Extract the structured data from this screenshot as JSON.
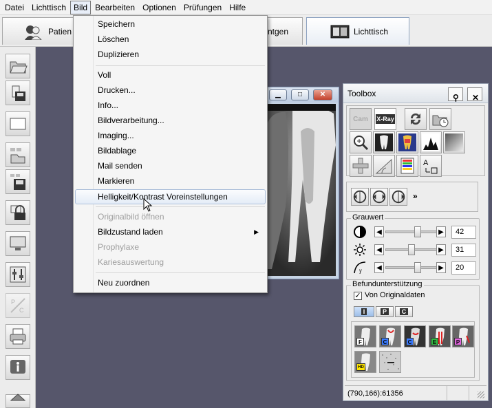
{
  "menubar": {
    "items": [
      "Datei",
      "Lichttisch",
      "Bild",
      "Bearbeiten",
      "Optionen",
      "Prüfungen",
      "Hilfe"
    ]
  },
  "tabs": [
    {
      "label": "Patien",
      "icon": "patient-icon"
    },
    {
      "label": "ntgen",
      "icon": "xray-icon"
    },
    {
      "label": "Lichttisch",
      "icon": "lighttable-icon"
    }
  ],
  "bild_menu": {
    "items": [
      {
        "label": "Speichern",
        "enabled": true
      },
      {
        "label": "Löschen",
        "enabled": true
      },
      {
        "label": "Duplizieren",
        "enabled": true
      },
      {
        "label": "Voll",
        "enabled": true
      },
      {
        "label": "Drucken...",
        "enabled": true
      },
      {
        "label": "Info...",
        "enabled": true
      },
      {
        "label": "Bildverarbeitung...",
        "enabled": true
      },
      {
        "label": "Imaging...",
        "enabled": true
      },
      {
        "label": "Bildablage",
        "enabled": true
      },
      {
        "label": "Mail senden",
        "enabled": true
      },
      {
        "label": "Markieren",
        "enabled": true
      },
      {
        "label": "Helligkeit/Kontrast Voreinstellungen",
        "enabled": true,
        "highlighted": true
      },
      {
        "label": "Originalbild öffnen",
        "enabled": false
      },
      {
        "label": "Bildzustand laden",
        "enabled": true,
        "submenu": true
      },
      {
        "label": "Prophylaxe",
        "enabled": false
      },
      {
        "label": "Kariesauswertung",
        "enabled": false
      },
      {
        "label": "Neu zuordnen",
        "enabled": true
      }
    ]
  },
  "toolbox": {
    "title": "Toolbox",
    "cam_label": "Cam",
    "xray_label": "X-Ray",
    "grauwert": {
      "caption": "Grauwert",
      "contrast_value": "42",
      "brightness_value": "31",
      "gamma_value": "20",
      "contrast_level": 0.42,
      "brightness_level": 0.31,
      "gamma_level": 0.42
    },
    "befund": {
      "caption": "Befundunterstützung",
      "checkbox_label": "Von Originaldaten",
      "checked": true,
      "tabs": [
        "I",
        "P",
        "C"
      ],
      "filters": [
        "F",
        "C",
        "C",
        "E",
        "P",
        "HD"
      ]
    },
    "status": "(790,166):61356"
  },
  "colors": {
    "desktop": "#56566b",
    "highlight_border": "#aec0da",
    "disabled_text": "#9d9d9d",
    "filter_colors": [
      "#ffffff",
      "#3a7bff",
      "#3a7bff",
      "#33bb44",
      "#e066dd",
      "#ffe600"
    ]
  }
}
